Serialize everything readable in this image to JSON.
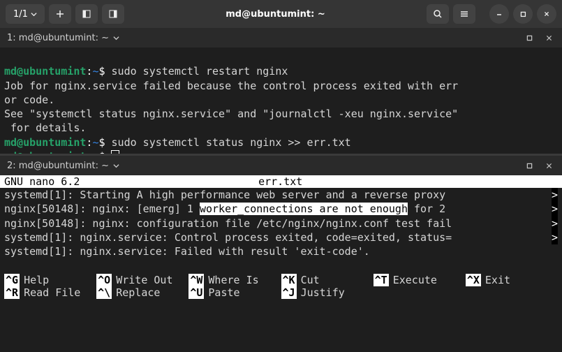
{
  "titlebar": {
    "tab_count": "1/1",
    "title": "md@ubuntumint: ~"
  },
  "pane1": {
    "label": "1: md@ubuntumint: ~",
    "prompt_user": "md@ubuntumint",
    "prompt_sep": ":",
    "prompt_path": "~",
    "prompt_dollar": "$ ",
    "cmd1": "sudo systemctl restart nginx",
    "out1a": "Job for nginx.service failed because the control process exited with err",
    "out1b": "or code.",
    "out1c": "See \"systemctl status nginx.service\" and \"journalctl -xeu nginx.service\"",
    "out1d": " for details.",
    "cmd2": "sudo systemctl status nginx >> err.txt"
  },
  "pane2": {
    "label": "2: md@ubuntumint: ~",
    "nano_version": " GNU nano 6.2",
    "nano_file": "err.txt",
    "lines": [
      {
        "pre": "systemd[1]: Starting A high performance web server and a reverse proxy ",
        "hl": "",
        "post": "",
        "edge": ">"
      },
      {
        "pre": "nginx[50148]: nginx: [emerg] 1 ",
        "hl": "worker_connections are not enough",
        "post": " for 2 ",
        "edge": ">"
      },
      {
        "pre": "nginx[50148]: nginx: configuration file /etc/nginx/nginx.conf test fail",
        "hl": "",
        "post": "",
        "edge": ">"
      },
      {
        "pre": "systemd[1]: nginx.service: Control process exited, code=exited, status=",
        "hl": "",
        "post": "",
        "edge": ">"
      },
      {
        "pre": "systemd[1]: nginx.service: Failed with result 'exit-code'.",
        "hl": "",
        "post": "",
        "edge": ""
      }
    ],
    "shortcuts": [
      {
        "k": "^G",
        "l": "Help"
      },
      {
        "k": "^O",
        "l": "Write Out"
      },
      {
        "k": "^W",
        "l": "Where Is"
      },
      {
        "k": "^K",
        "l": "Cut"
      },
      {
        "k": "^T",
        "l": "Execute"
      },
      {
        "k": "^X",
        "l": "Exit"
      },
      {
        "k": "^R",
        "l": "Read File"
      },
      {
        "k": "^\\",
        "l": "Replace"
      },
      {
        "k": "^U",
        "l": "Paste"
      },
      {
        "k": "^J",
        "l": "Justify"
      }
    ]
  }
}
